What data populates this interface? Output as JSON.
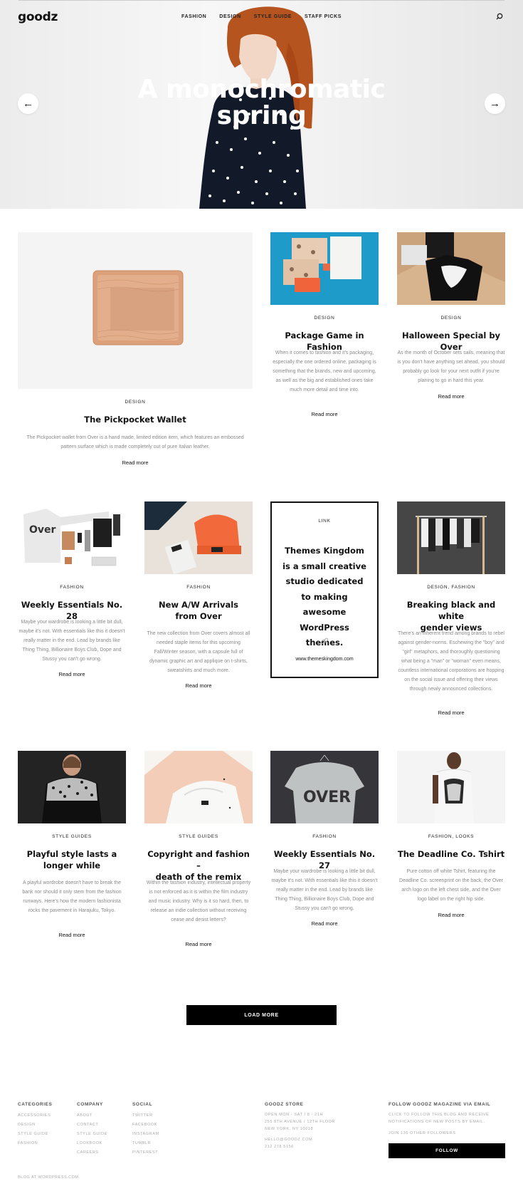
{
  "header": {
    "logo": "goodz",
    "nav": [
      "FASHION",
      "DESIGN",
      "STYLE GUIDE",
      "STAFF PICKS"
    ]
  },
  "hero": {
    "title_line1": "A monochromatic",
    "title_line2": "spring",
    "prev_arrow": "←",
    "next_arrow": "→"
  },
  "posts": [
    {
      "category": "DESIGN",
      "title": "The Pickpocket Wallet",
      "excerpt": "The Pickpocket wallet from Over is a hand made, limited edition item, which features an embossed pattern surface which is made completely out of pure Italian leather.",
      "read_more": "Read more"
    },
    {
      "category": "DESIGN",
      "title": "Package Game in Fashion",
      "excerpt": "When it comes to fashion and it's packaging, especially the one ordered online, packaging is something that the brands, new and upcoming, as well as the big and established ones take much more detail and time into.",
      "read_more": "Read more"
    },
    {
      "category": "DESIGN",
      "title": "Halloween Special by Over",
      "excerpt": "As the month of October sets sails, meaning that is you don't have anything set ahead, you should probably go look for your next outfit if you're planing to go in hard this year.",
      "read_more": "Read more"
    },
    {
      "category": "FASHION",
      "title": "Weekly Essentials No. 28",
      "excerpt": "Maybe your wardrobe is looking a little bit dull, maybe it's not. With essentials like this it doesn't really matter in the end. Lead by brands like Thing Thing, Billionaire Boys Club, Dope and Stussy you can't go wrong.",
      "read_more": "Read more"
    },
    {
      "category": "FASHION",
      "title_line1": "New A/W Arrivals",
      "title_line2": "from Over",
      "excerpt": "The new collection from Over covers almost all needed staple items for this upcoming Fall/Winter season, with a capsule full of dynamic graphic art and applique on t-shirts, sweatshirts and much more.",
      "read_more": "Read more"
    },
    {
      "category": "DESIGN, FASHION",
      "title_line1": "Breaking black and white",
      "title_line2": "gender views",
      "excerpt": "There's an inherent trend among brands to rebel against gender-norms. Eschewing the \"boy\" and \"girl\" metaphors, and thoroughly questioning what being a \"man\" or \"woman\" even means, countless international corporations are hopping on the social issue and offering their views through newly announced collections.",
      "read_more": "Read more"
    },
    {
      "category": "STYLE GUIDES",
      "title_line1": "Playful style lasts a",
      "title_line2": "longer while",
      "excerpt": "A playful wordrobe doesn't have to break the bank nor should it only stem from the fashion runways. Here's how the modern fashionista rocks the pavement in Harajuku, Tokyo.",
      "read_more": "Read more"
    },
    {
      "category": "STYLE GUIDES",
      "title_line1": "Copyright and fashion –",
      "title_line2": "death of the remix",
      "excerpt": "Within the fashion industry, intellectual property is not enforced as it is within the film industry and music industry. Why is it so hard, then, to release an indie collection without receiving cease and desist letters?",
      "read_more": "Read more"
    },
    {
      "category": "FASHION",
      "title": "Weekly Essentials No. 27",
      "excerpt": "Maybe your wardrobe is looking a little bit dull, maybe it's not. With essentials like this it doesn't really matter in the end. Lead by brands like Thing Thing, Billionaire Boys Club, Dope and Stussy you can't go wrong.",
      "read_more": "Read more"
    },
    {
      "category": "FASHION, LOOKS",
      "title": "The Deadline Co. Tshirt",
      "excerpt": "Pure cotton off white Tshirt, featuring the Deadline Co. screenprint on the back, the Over arch logo on the left chest side, and the Over logo label on the right hip side.",
      "read_more": "Read more"
    }
  ],
  "link_card": {
    "label": "LINK",
    "text": "Themes Kingdom is a small creative studio dedicated to making awesome WordPress themes.",
    "url": "www.themeskingdom.com"
  },
  "load_more": "LOAD MORE",
  "footer": {
    "categories": {
      "heading": "CATEGORIES",
      "items": [
        "ACCESSORIES",
        "DESIGN",
        "STYLE GUIDE",
        "FASHION"
      ]
    },
    "company": {
      "heading": "COMPANY",
      "items": [
        "ABOUT",
        "CONTACT",
        "STYLE GUIDE",
        "LOOKBOOK",
        "CAREERS"
      ]
    },
    "social": {
      "heading": "SOCIAL",
      "items": [
        "TWITTER",
        "FACEBOOK",
        "INSTAGRAM",
        "TUMBLR",
        "PINTEREST"
      ]
    },
    "store": {
      "heading": "GOODZ STORE",
      "lines": [
        "OPEN MON - SAT / 8 - 21H",
        "255 8TH AVENUE / 12TH FLOOR",
        "NEW YORK, NY 10018"
      ],
      "email": "HELLO@GOODZ.COM",
      "phone": "212 278 5156"
    },
    "follow": {
      "heading": "FOLLOW GOODZ MAGAZINE VIA EMAIL",
      "text_line1": "CLICK TO FOLLOW THIS BLOG AND RECEIVE",
      "text_line2": "NOTIFICATIONS OF NEW POSTS BY EMAIL.",
      "followers": "JOIN 135 OTHER FOLLOWERS",
      "button": "FOLLOW"
    },
    "credit": "BLOG AT WORDPRESS.COM."
  }
}
